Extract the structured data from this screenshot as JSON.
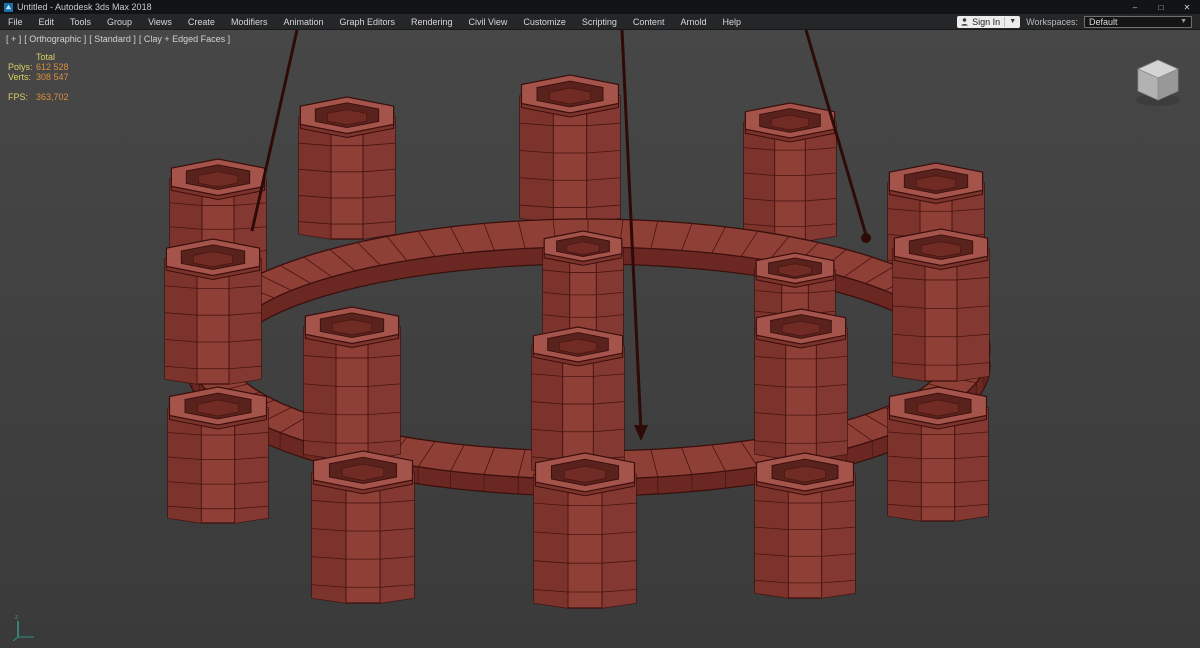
{
  "window": {
    "title": "Untitled - Autodesk 3ds Max 2018",
    "minimize": "–",
    "maximize": "□",
    "close": "✕"
  },
  "menu_bar": {
    "items": [
      "File",
      "Edit",
      "Tools",
      "Group",
      "Views",
      "Create",
      "Modifiers",
      "Animation",
      "Graph Editors",
      "Rendering",
      "Civil View",
      "Customize",
      "Scripting",
      "Content",
      "Arnold",
      "Help"
    ],
    "sign_in": "Sign In",
    "workspaces_label": "Workspaces:",
    "workspace_value": "Default"
  },
  "viewport": {
    "label_segments": [
      "[ + ]",
      "[ Orthographic ]",
      "[ Standard ]",
      "[ Clay + Edged Faces ]"
    ],
    "stats": {
      "total_label": "Total",
      "polys_label": "Polys:",
      "polys_value": "612 528",
      "verts_label": "Verts:",
      "verts_value": "308 547",
      "fps_label": "FPS:",
      "fps_value": "363,702"
    },
    "colors": {
      "background": "#3f3f3f",
      "model_fill": "#8e3f36",
      "model_left": "#7c332c",
      "model_right": "#833931",
      "rim": "#a5544b",
      "rim_lower": "#7c332c",
      "opening": "#5a221d",
      "opening_floor": "#6f2b24",
      "edge": "#3a0f0c",
      "wire_line": "#4a1410",
      "ring_bottom": "#6b2822",
      "suspension": "#2e0a08",
      "stats_label": "#d8cf62",
      "stats_value": "#d8913c"
    }
  }
}
